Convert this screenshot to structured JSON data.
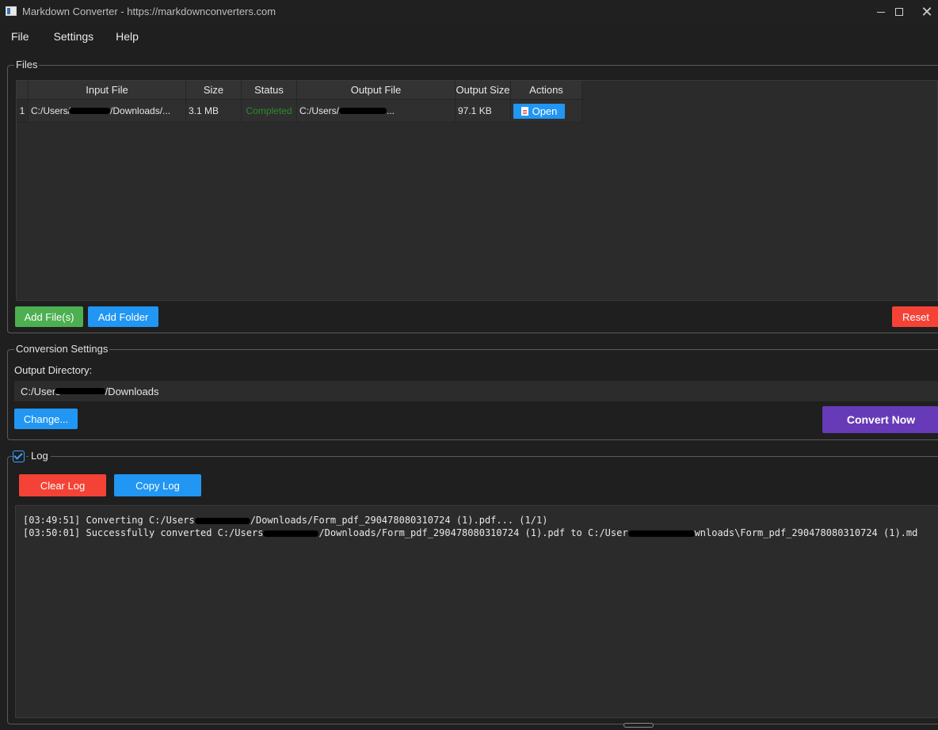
{
  "window": {
    "title": "Markdown Converter - https://markdownconverters.com",
    "minimize_icon": "minimize-icon",
    "maximize_icon": "maximize-icon",
    "close_icon": "close-icon",
    "close_glyph": "✕"
  },
  "menu": {
    "items": [
      "File",
      "Settings",
      "Help"
    ]
  },
  "files": {
    "group_title": "Files",
    "columns": [
      "Input File",
      "Size",
      "Status",
      "Output File",
      "Output Size",
      "Actions"
    ],
    "rows": [
      {
        "num": "1",
        "input_prefix": "C:/Users/",
        "input_suffix": "/Downloads/...",
        "size": "3.1 MB",
        "status": "Completed",
        "output_prefix": "C:/Users/",
        "output_suffix": "...",
        "output_size": "97.1 KB",
        "action_label": "Open"
      }
    ],
    "add_files_label": "Add File(s)",
    "add_folder_label": "Add Folder",
    "reset_label": "Reset"
  },
  "conversion": {
    "group_title": "Conversion Settings",
    "output_dir_label": "Output Directory:",
    "output_dir_prefix": "C:/Users",
    "output_dir_suffix": "/Downloads",
    "change_label": "Change...",
    "convert_label": "Convert Now"
  },
  "log": {
    "group_title": "Log",
    "checked": true,
    "clear_label": "Clear Log",
    "copy_label": "Copy Log",
    "lines": [
      {
        "pre": "[03:49:51] Converting C:/Users",
        "post": "/Downloads/Form_pdf_290478080310724 (1).pdf... (1/1)"
      },
      {
        "pre": "[03:50:01] Successfully converted C:/Users",
        "mid": "/Downloads/Form_pdf_290478080310724 (1).pdf to C:/User",
        "post": "wnloads\\Form_pdf_290478080310724 (1).md"
      }
    ]
  },
  "colors": {
    "green": "#4caf50",
    "blue": "#2196f3",
    "red": "#f44336",
    "purple": "#673ab7",
    "status_completed": "#2e8b2e"
  }
}
